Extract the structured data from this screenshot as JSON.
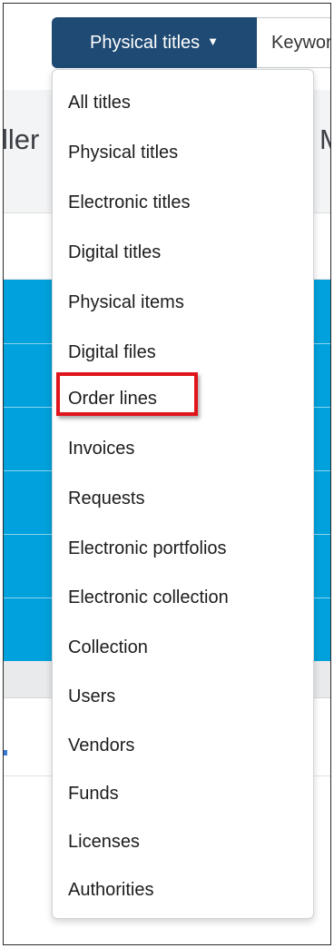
{
  "search": {
    "type_label": "Physical titles",
    "caret": "▼",
    "keyword_text": "Keywords"
  },
  "background": {
    "heading_left": "ller",
    "heading_right": "M"
  },
  "menu": {
    "items": [
      "All titles",
      "Physical titles",
      "Electronic titles",
      "Digital titles",
      "Physical items",
      "Digital files",
      "Order lines",
      "Invoices",
      "Requests",
      "Electronic portfolios",
      "Electronic collection",
      "Collection",
      "Users",
      "Vendors",
      "Funds",
      "Licenses",
      "Authorities"
    ],
    "highlighted_item": "Order lines"
  },
  "colors": {
    "button_bg": "#1e4a73",
    "accent_blue": "#00a1dc",
    "highlight_border": "#e0151c"
  }
}
